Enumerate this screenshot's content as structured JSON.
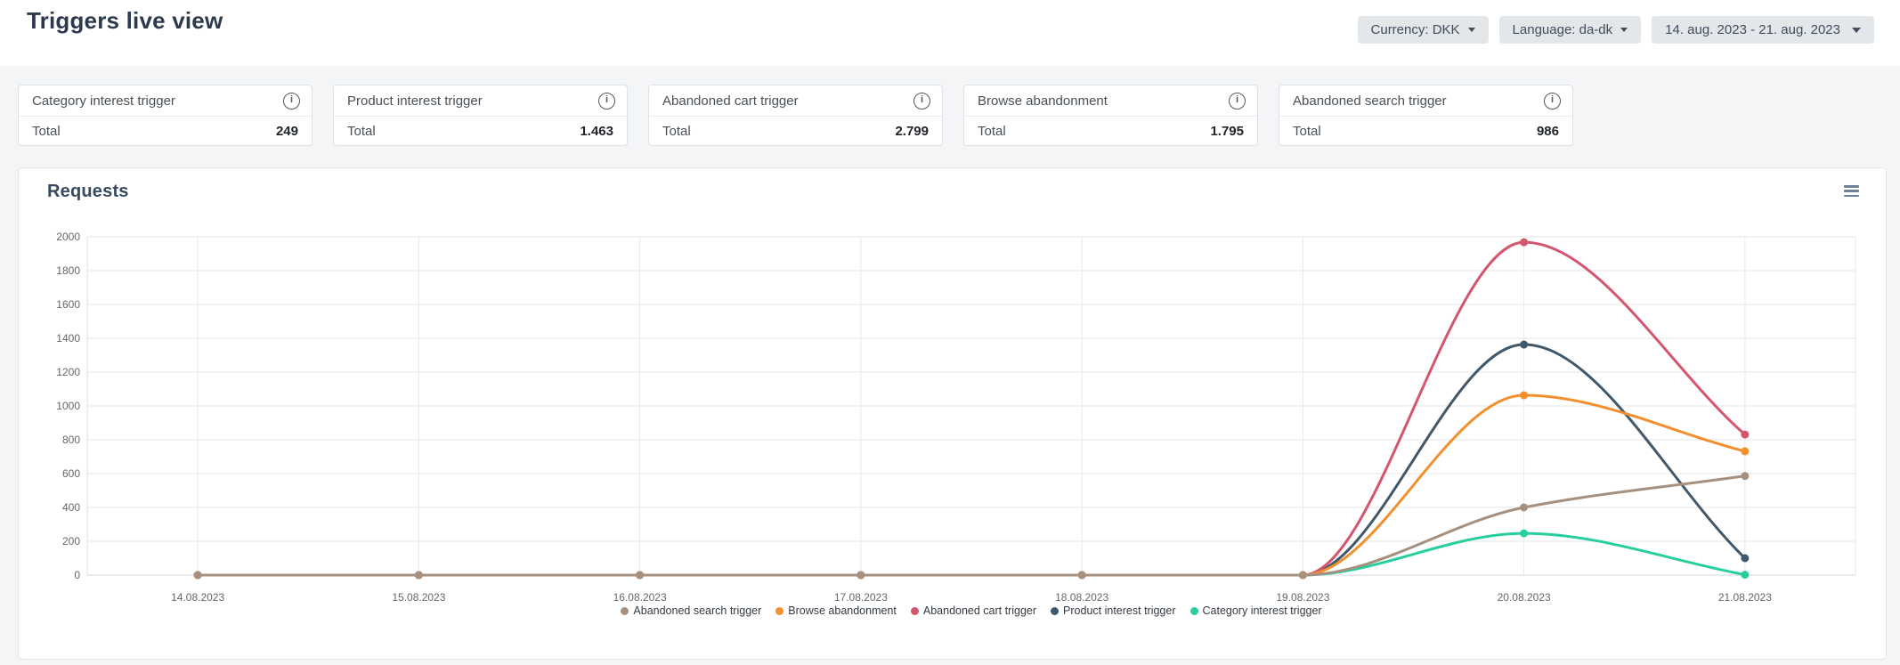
{
  "header": {
    "title": "Triggers live view",
    "filters": [
      {
        "label": "Currency: DKK"
      },
      {
        "label": "Language: da-dk"
      },
      {
        "label": "14. aug. 2023 - 21. aug. 2023"
      }
    ]
  },
  "icons": {
    "info": "i",
    "menu": "hamburger-lines",
    "caret": "triangle-down"
  },
  "cards": [
    {
      "title": "Category interest trigger",
      "total_label": "Total",
      "value": "249"
    },
    {
      "title": "Product interest trigger",
      "total_label": "Total",
      "value": "1.463"
    },
    {
      "title": "Abandoned cart trigger",
      "total_label": "Total",
      "value": "2.799"
    },
    {
      "title": "Browse abandonment",
      "total_label": "Total",
      "value": "1.795"
    },
    {
      "title": "Abandoned search trigger",
      "total_label": "Total",
      "value": "986"
    }
  ],
  "chart": {
    "title": "Requests"
  },
  "chart_data": {
    "type": "line",
    "title": "Requests",
    "categories": [
      "14.08.2023",
      "15.08.2023",
      "16.08.2023",
      "17.08.2023",
      "18.08.2023",
      "19.08.2023",
      "20.08.2023",
      "21.08.2023"
    ],
    "series": [
      {
        "name": "Abandoned search trigger",
        "color": "#a6907f",
        "values": [
          0,
          0,
          0,
          0,
          0,
          0,
          400,
          586
        ]
      },
      {
        "name": "Browse abandonment",
        "color": "#f28f2e",
        "values": [
          0,
          0,
          0,
          0,
          0,
          0,
          1063,
          732
        ]
      },
      {
        "name": "Abandoned cart trigger",
        "color": "#d4566e",
        "values": [
          0,
          0,
          0,
          0,
          0,
          0,
          1968,
          831
        ]
      },
      {
        "name": "Product interest trigger",
        "color": "#41586b",
        "values": [
          0,
          0,
          0,
          0,
          0,
          0,
          1363,
          100
        ]
      },
      {
        "name": "Category interest trigger",
        "color": "#26cf9d",
        "values": [
          0,
          0,
          0,
          0,
          0,
          0,
          247,
          2
        ]
      }
    ],
    "xlabel": "",
    "ylabel": "",
    "ylim": [
      0,
      2000
    ],
    "ytick_step": 200,
    "grid": true,
    "legend_position": "bottom",
    "curve": "spline",
    "markers": true
  }
}
